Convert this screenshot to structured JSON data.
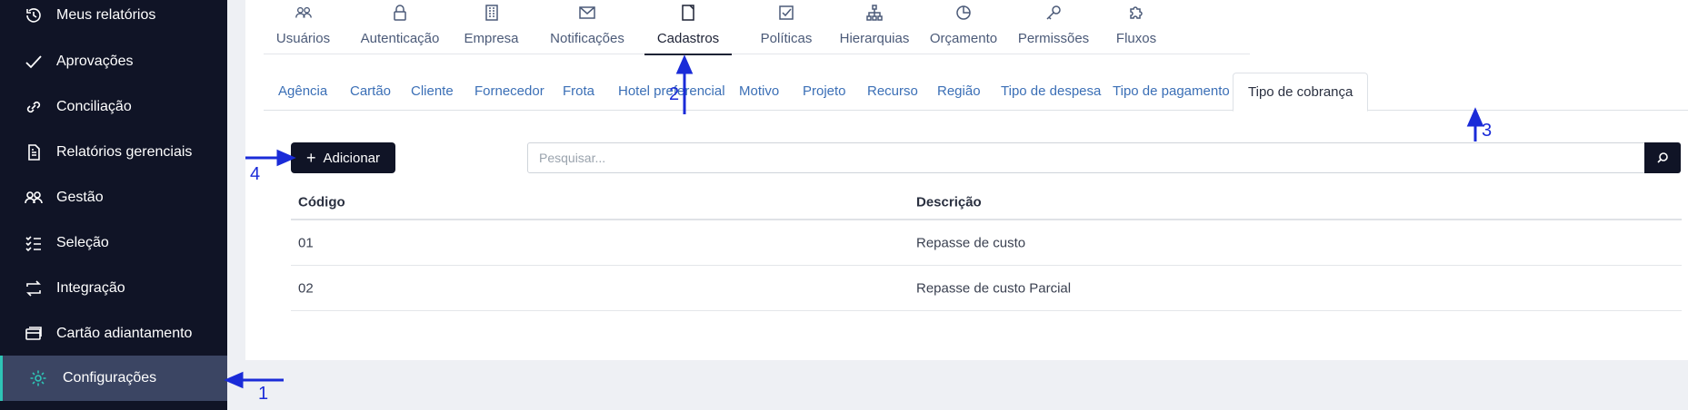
{
  "sidebar": {
    "items": [
      {
        "label": "Meus relatórios",
        "icon": "history-icon"
      },
      {
        "label": "Aprovações",
        "icon": "check-icon"
      },
      {
        "label": "Conciliação",
        "icon": "link-icon"
      },
      {
        "label": "Relatórios gerenciais",
        "icon": "document-icon"
      },
      {
        "label": "Gestão",
        "icon": "users-icon"
      },
      {
        "label": "Seleção",
        "icon": "checklist-icon"
      },
      {
        "label": "Integração",
        "icon": "sync-icon"
      },
      {
        "label": "Cartão adiantamento",
        "icon": "card-icon"
      },
      {
        "label": "Configurações",
        "icon": "gear-icon",
        "active": true
      }
    ]
  },
  "topnav": {
    "tabs": [
      {
        "label": "Usuários",
        "icon": "users-icon"
      },
      {
        "label": "Autenticação",
        "icon": "lock-icon"
      },
      {
        "label": "Empresa",
        "icon": "building-icon"
      },
      {
        "label": "Notificações",
        "icon": "mail-icon"
      },
      {
        "label": "Cadastros",
        "icon": "note-icon",
        "active": true
      },
      {
        "label": "Políticas",
        "icon": "checkbox-icon"
      },
      {
        "label": "Hierarquias",
        "icon": "hierarchy-icon"
      },
      {
        "label": "Orçamento",
        "icon": "pie-chart-icon"
      },
      {
        "label": "Permissões",
        "icon": "key-icon"
      },
      {
        "label": "Fluxos",
        "icon": "puzzle-icon"
      }
    ]
  },
  "subtabs": [
    "Agência",
    "Cartão",
    "Cliente",
    "Fornecedor",
    "Frota",
    "Hotel preferencial",
    "Motivo",
    "Projeto",
    "Recurso",
    "Região",
    "Tipo de despesa",
    "Tipo de pagamento",
    "Tipo de cobrança"
  ],
  "active_subtab": "Tipo de cobrança",
  "toolbar": {
    "add_label": "Adicionar",
    "search_placeholder": "Pesquisar..."
  },
  "table": {
    "columns": [
      "Código",
      "Descrição"
    ],
    "rows": [
      [
        "01",
        "Repasse de custo"
      ],
      [
        "02",
        "Repasse de custo Parcial"
      ]
    ]
  },
  "annotations": [
    "1",
    "2",
    "3",
    "4"
  ],
  "colors": {
    "sidebar_bg": "#101426",
    "active_accent": "#2ec4b6",
    "link_blue": "#3b6fb6",
    "annotation_blue": "#1a2bd8"
  }
}
